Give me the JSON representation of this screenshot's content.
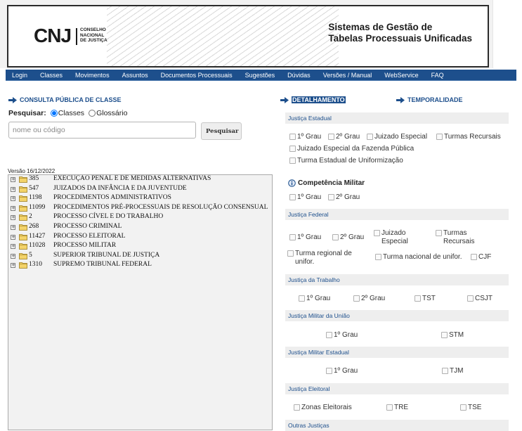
{
  "banner": {
    "logo_text": "CNJ",
    "logo_sub": [
      "CONSELHO",
      "NACIONAL",
      "DE JUSTIÇA"
    ],
    "title_line1": "Sistemas de Gestão de",
    "title_line2": "Tabelas Processuais Unificadas"
  },
  "nav": [
    "Login",
    "Classes",
    "Movimentos",
    "Assuntos",
    "Documentos Processuais",
    "Sugestões",
    "Dúvidas",
    "Versões / Manual",
    "WebService",
    "FAQ"
  ],
  "left": {
    "section_title": "CONSULTA PÚBLICA DE CLASSE",
    "search_label": "Pesquisar:",
    "radio_classes": "Classes",
    "radio_glossario": "Glossário",
    "search_placeholder": "nome ou código",
    "search_button": "Pesquisar",
    "version": "Versão 16/12/2022"
  },
  "tree": [
    {
      "code": "385",
      "label": "EXECUÇÃO PENAL E DE MEDIDAS ALTERNATIVAS"
    },
    {
      "code": "547",
      "label": "JUIZADOS DA INFÂNCIA E DA JUVENTUDE"
    },
    {
      "code": "1198",
      "label": "PROCEDIMENTOS ADMINISTRATIVOS"
    },
    {
      "code": "11099",
      "label": "PROCEDIMENTOS PRÉ-PROCESSUAIS DE RESOLUÇÃO CONSENSUAL"
    },
    {
      "code": "2",
      "label": "PROCESSO CÍVEL E DO TRABALHO"
    },
    {
      "code": "268",
      "label": "PROCESSO CRIMINAL"
    },
    {
      "code": "11427",
      "label": "PROCESSO ELEITORAL"
    },
    {
      "code": "11028",
      "label": "PROCESSO MILITAR"
    },
    {
      "code": "5",
      "label": "SUPERIOR TRIBUNAL DE JUSTIÇA"
    },
    {
      "code": "1310",
      "label": "SUPREMO TRIBUNAL FEDERAL"
    }
  ],
  "right": {
    "tab_detalhamento": "DETALHAMENTO",
    "tab_temporalidade": "TEMPORALIDADE",
    "estadual": {
      "header": "Justiça Estadual",
      "options": [
        "1º Grau",
        "2º Grau",
        "Juizado Especial",
        "Turmas Recursais",
        "Juizado Especial da Fazenda Pública",
        "Turma Estadual de Uniformização"
      ]
    },
    "militar_comp": {
      "title": "Competência Militar",
      "options": [
        "1º Grau",
        "2º Grau"
      ]
    },
    "federal": {
      "header": "Justiça Federal",
      "options": [
        "1º Grau",
        "2º Grau",
        "Juizado Especial",
        "Turmas Recursais",
        "Turma regional de unifor.",
        "Turma nacional de unifor.",
        "CJF"
      ]
    },
    "trabalho": {
      "header": "Justiça da Trabalho",
      "options": [
        "1º Grau",
        "2º Grau",
        "TST",
        "CSJT"
      ]
    },
    "militar_uniao": {
      "header": "Justiça Militar da União",
      "options": [
        "1º Grau",
        "STM"
      ]
    },
    "militar_estadual": {
      "header": "Justiça Militar Estadual",
      "options": [
        "1º Grau",
        "TJM"
      ]
    },
    "eleitoral": {
      "header": "Justiça Eleitoral",
      "options": [
        "Zonas Eleitorais",
        "TRE",
        "TSE"
      ]
    },
    "outras": {
      "header": "Outras Justiças"
    }
  },
  "colors": {
    "nav_bg": "#1d4f8c",
    "section_title": "#1d4f8c",
    "category_bg": "#eeeeee"
  }
}
